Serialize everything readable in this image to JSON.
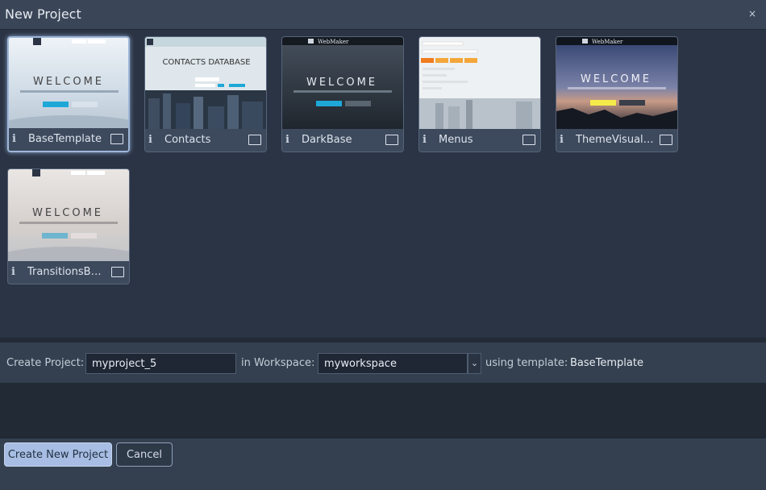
{
  "window": {
    "title": "New Project",
    "close_glyph": "×"
  },
  "templates": [
    {
      "name": "BaseTemplate",
      "selected": true,
      "info_glyph": "i",
      "preview_icon": "image-icon"
    },
    {
      "name": "Contacts",
      "selected": false,
      "info_glyph": "i",
      "preview_icon": "image-icon"
    },
    {
      "name": "DarkBase",
      "selected": false,
      "info_glyph": "i",
      "preview_icon": "image-icon"
    },
    {
      "name": "Menus",
      "selected": false,
      "info_glyph": "i",
      "preview_icon": "image-icon"
    },
    {
      "name": "ThemeVisualizer",
      "selected": false,
      "info_glyph": "i",
      "preview_icon": "image-icon"
    },
    {
      "name": "TransitionsBase",
      "selected": false,
      "info_glyph": "i",
      "preview_icon": "image-icon"
    }
  ],
  "thumbs": {
    "welcome": "WELCOME",
    "contacts_db": "CONTACTS DATABASE",
    "webmaker": "WebMaker"
  },
  "form": {
    "create_label": "Create Project:",
    "project_name": "myproject_5",
    "workspace_label": "in Workspace:",
    "workspace": "myworkspace",
    "template_label": "using template:",
    "template": "BaseTemplate"
  },
  "buttons": {
    "create": "Create New Project",
    "cancel": "Cancel"
  },
  "colors": {
    "accent": "#a7bde3",
    "selected_border": "#9fb6d8",
    "background": "#2b3444"
  }
}
